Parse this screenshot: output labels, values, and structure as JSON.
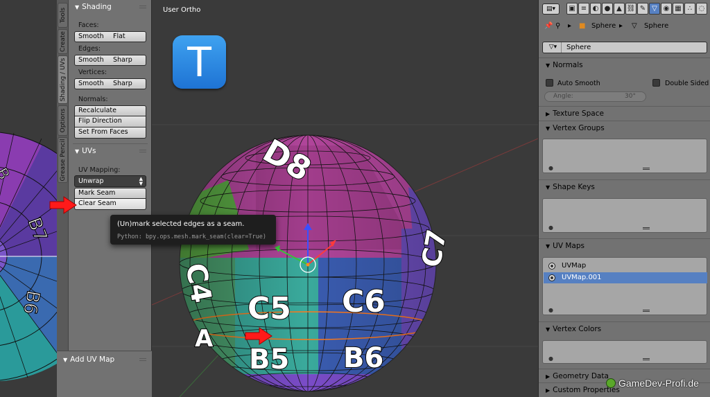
{
  "tool_tabs": [
    {
      "label": "Tools"
    },
    {
      "label": "Create"
    },
    {
      "label": "Shading / UVs",
      "active": true
    },
    {
      "label": "Options"
    },
    {
      "label": "Grease Pencil"
    }
  ],
  "shading_panel": {
    "title": "Shading",
    "faces_label": "Faces:",
    "edges_label": "Edges:",
    "vertices_label": "Vertices:",
    "normals_label": "Normals:",
    "smooth": "Smooth",
    "flat": "Flat",
    "sharp": "Sharp",
    "recalculate": "Recalculate",
    "flip_direction": "Flip Direction",
    "set_from_faces": "Set From Faces"
  },
  "uvs_panel": {
    "title": "UVs",
    "uv_mapping_label": "UV Mapping:",
    "unwrap": "Unwrap",
    "mark_seam": "Mark Seam",
    "clear_seam": "Clear Seam"
  },
  "operator_panel": {
    "title": "Add UV Map"
  },
  "viewport": {
    "label": "User Ortho",
    "logo_letter": "T"
  },
  "sphere_labels": {
    "d8": "D8",
    "c4": "C4",
    "c5": "C5",
    "c6": "C6",
    "c7": "C7",
    "b5": "B5",
    "b6": "B6",
    "a": "A"
  },
  "uv_editor_labels": {
    "b7": "B7",
    "b6": "B6",
    "b": "B"
  },
  "tooltip": {
    "title": "(Un)mark selected edges as a seam.",
    "python": "Python: bpy.ops.mesh.mark_seam(clear=True)"
  },
  "properties": {
    "breadcrumb_object": "Sphere",
    "breadcrumb_mesh": "Sphere",
    "mesh_name": "Sphere",
    "normals": {
      "title": "Normals",
      "auto_smooth": "Auto Smooth",
      "double_sided": "Double Sided",
      "angle_label": "Angle:",
      "angle_value": "30°"
    },
    "texture_space": "Texture Space",
    "vertex_groups": "Vertex Groups",
    "shape_keys": "Shape Keys",
    "uv_maps": {
      "title": "UV Maps",
      "items": [
        "UVMap",
        "UVMap.001"
      ],
      "selected": "UVMap.001"
    },
    "vertex_colors": "Vertex Colors",
    "geometry_data": "Geometry Data",
    "custom_properties": "Custom Properties"
  },
  "watermark": "GameDev-Profi.de",
  "colors": {
    "accent_selected": "#5680c2",
    "seam_orange": "#ff7a1c",
    "arrow_red": "#ff1a1a",
    "sphere_magenta": "#b0459a",
    "sphere_teal": "#3aaa9c",
    "sphere_blue": "#3a5cb0",
    "sphere_purple": "#6a4cb8"
  }
}
